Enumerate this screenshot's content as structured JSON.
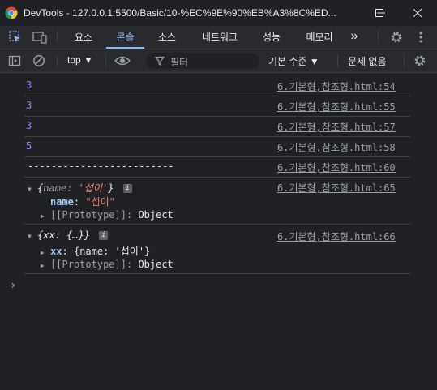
{
  "window": {
    "title": "DevTools - 127.0.0.1:5500/Basic/10-%EC%9E%90%EB%A3%8C%ED..."
  },
  "tabs": [
    {
      "label": "요소"
    },
    {
      "label": "콘솔"
    },
    {
      "label": "소스"
    },
    {
      "label": "네트워크"
    },
    {
      "label": "성능"
    },
    {
      "label": "메모리"
    }
  ],
  "tabs_more": "»",
  "toolbar": {
    "context": "top ▼",
    "filter_placeholder": "필터",
    "levels": "기본 수준 ▼",
    "issues": "문제 없음"
  },
  "console": {
    "messages": [
      {
        "value": "3",
        "source": "6.기본형,참조형.html:54"
      },
      {
        "value": "3",
        "source": "6.기본형,참조형.html:55"
      },
      {
        "value": "3",
        "source": "6.기본형,참조형.html:57"
      },
      {
        "value": "5",
        "source": "6.기본형,참조형.html:58"
      },
      {
        "value": "-------------------------",
        "source": "6.기본형,참조형.html:60"
      }
    ],
    "obj1": {
      "summary_open": "{",
      "summary_key": "name",
      "summary_sep": ": ",
      "summary_val": "'섭이'",
      "summary_close": "}",
      "source": "6.기본형,참조형.html:65",
      "prop_key": "name",
      "prop_sep": ": ",
      "prop_val": "\"섭이\"",
      "proto": "[[Prototype]]",
      "proto_sep": ": ",
      "proto_val": "Object"
    },
    "obj2": {
      "summary": "{xx: {…}}",
      "source": "6.기본형,참조형.html:66",
      "prop_key": "xx",
      "prop_sep": ": ",
      "prop_val": "{name: '섭이'}",
      "proto": "[[Prototype]]",
      "proto_sep": ": ",
      "proto_val": "Object"
    },
    "prompt": "›"
  },
  "colors": {
    "background": "#202124",
    "accent": "#8ab4f8",
    "number": "#9980ff",
    "string": "#f28b82"
  }
}
